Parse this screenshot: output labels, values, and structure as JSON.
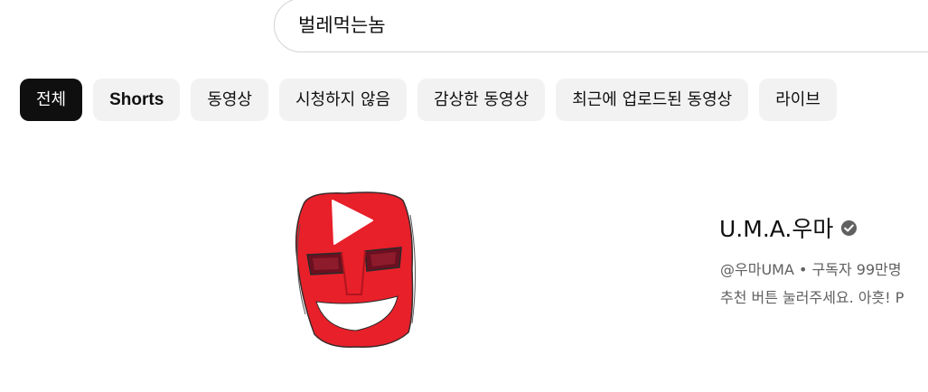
{
  "search": {
    "query": "벌레먹는놈"
  },
  "chips": [
    {
      "label": "전체",
      "active": true
    },
    {
      "label": "Shorts"
    },
    {
      "label": "동영상"
    },
    {
      "label": "시청하지 않음"
    },
    {
      "label": "감상한 동영상"
    },
    {
      "label": "최근에 업로드된 동영상"
    },
    {
      "label": "라이브"
    }
  ],
  "channel": {
    "name": "U.M.A.우마",
    "handle": "@우마UMA",
    "separator": "•",
    "subscribers": "구독자 99만명",
    "description": "추천 버튼 눌러주세요. 아흣! P",
    "avatar_icon": "red-mask-play-icon",
    "verified_icon": "verified-check-icon"
  },
  "colors": {
    "chip_bg": "#f2f2f2",
    "chip_active_bg": "#0f0f0f",
    "avatar_red": "#e8202a",
    "meta_text": "#606060"
  }
}
